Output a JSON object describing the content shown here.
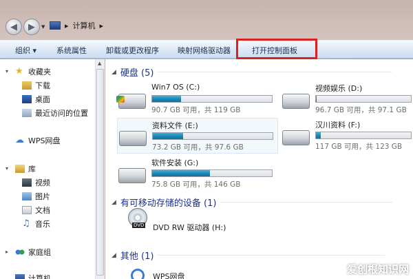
{
  "address": {
    "computer": "计算机",
    "sep": "▸",
    "sep2": "▸"
  },
  "toolbar": {
    "organize": "组织 ▾",
    "system_properties": "系统属性",
    "uninstall": "卸载或更改程序",
    "map_drive": "映射网络驱动器",
    "control_panel": "打开控制面板"
  },
  "sidebar": {
    "favorites": "收藏夹",
    "downloads": "下载",
    "desktop": "桌面",
    "recent": "最近访问的位置",
    "wps": "WPS网盘",
    "library": "库",
    "videos": "视频",
    "pictures": "图片",
    "documents": "文档",
    "music": "音乐",
    "homegroup": "家庭组",
    "computer": "计算机"
  },
  "groups": {
    "hard_disks": "硬盘 (5)",
    "removable": "有可移动存储的设备 (1)",
    "other": "其他 (1)"
  },
  "drives": [
    {
      "name": "Win7 OS (C:)",
      "info": "90.7 GB 可用，共 119 GB",
      "used_fraction": 0.24
    },
    {
      "name": "视频娱乐 (D:)",
      "info": "96.7 GB 可用，共 97.1 GB",
      "used_fraction": 0.01
    },
    {
      "name": "资料文件 (E:)",
      "info": "73.2 GB 可用，共 97.6 GB",
      "used_fraction": 0.25
    },
    {
      "name": "汉川资料 (F:)",
      "info": "117 GB 可用，共 123 GB",
      "used_fraction": 0.05
    },
    {
      "name": "软件安装 (G:)",
      "info": "75.8 GB 可用，共 146 GB",
      "used_fraction": 0.48
    }
  ],
  "dvd": {
    "name": "DVD RW 驱动器 (H:)",
    "badge": "DVD"
  },
  "other_item": "WPS网盘",
  "watermark": "爱创根知识网",
  "colors": {
    "bar_fill": "#1a86b3",
    "highlight_box": "#d92121",
    "group_text": "#1e3287"
  }
}
